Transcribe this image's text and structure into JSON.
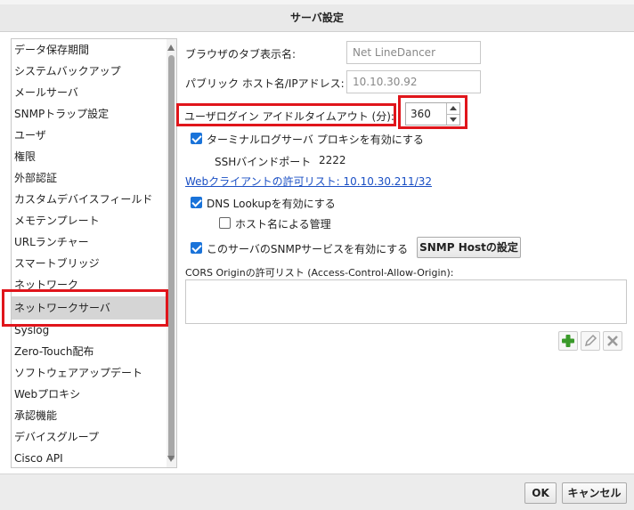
{
  "title": "サーバ設定",
  "sidebar": {
    "items": [
      {
        "label": "データ保存期間"
      },
      {
        "label": "システムバックアップ"
      },
      {
        "label": "メールサーバ"
      },
      {
        "label": "SNMPトラップ設定"
      },
      {
        "label": "ユーザ"
      },
      {
        "label": "権限"
      },
      {
        "label": "外部認証"
      },
      {
        "label": "カスタムデバイスフィールド"
      },
      {
        "label": "メモテンプレート"
      },
      {
        "label": "URLランチャー"
      },
      {
        "label": "スマートブリッジ"
      },
      {
        "label": "ネットワーク"
      },
      {
        "label": "ネットワークサーバ",
        "selected": true
      },
      {
        "label": "Syslog"
      },
      {
        "label": "Zero-Touch配布"
      },
      {
        "label": "ソフトウェアアップデート"
      },
      {
        "label": "Webプロキシ"
      },
      {
        "label": "承認機能"
      },
      {
        "label": "デバイスグループ"
      },
      {
        "label": "Cisco API"
      }
    ]
  },
  "form": {
    "browser_tab_label": "ブラウザのタブ表示名:",
    "browser_tab_value": "Net LineDancer",
    "public_host_label": "パブリック ホスト名/IPアドレス:",
    "public_host_value": "10.10.30.92",
    "idle_timeout_label": "ユーザログイン アイドルタイムアウト (分):",
    "idle_timeout_value": "360",
    "terminal_proxy_label": "ターミナルログサーバ プロキシを有効にする",
    "ssh_port_label": "SSHバインドポート",
    "ssh_port_value": "2222",
    "web_client_link": "Webクライアントの許可リスト: 10.10.30.211/32",
    "dns_lookup_label": "DNS Lookupを有効にする",
    "hostname_mgmt_label": "ホスト名による管理",
    "snmp_service_label": "このサーバのSNMPサービスを有効にする",
    "snmp_host_button": "SNMP Hostの設定",
    "cors_label": "CORS Originの許可リスト (Access-Control-Allow-Origin):"
  },
  "footer": {
    "ok_label": "OK",
    "cancel_label": "キャンセル"
  },
  "colors": {
    "highlight": "#e0151b",
    "checkbox": "#1a73d9",
    "link": "#1a4fc4"
  }
}
